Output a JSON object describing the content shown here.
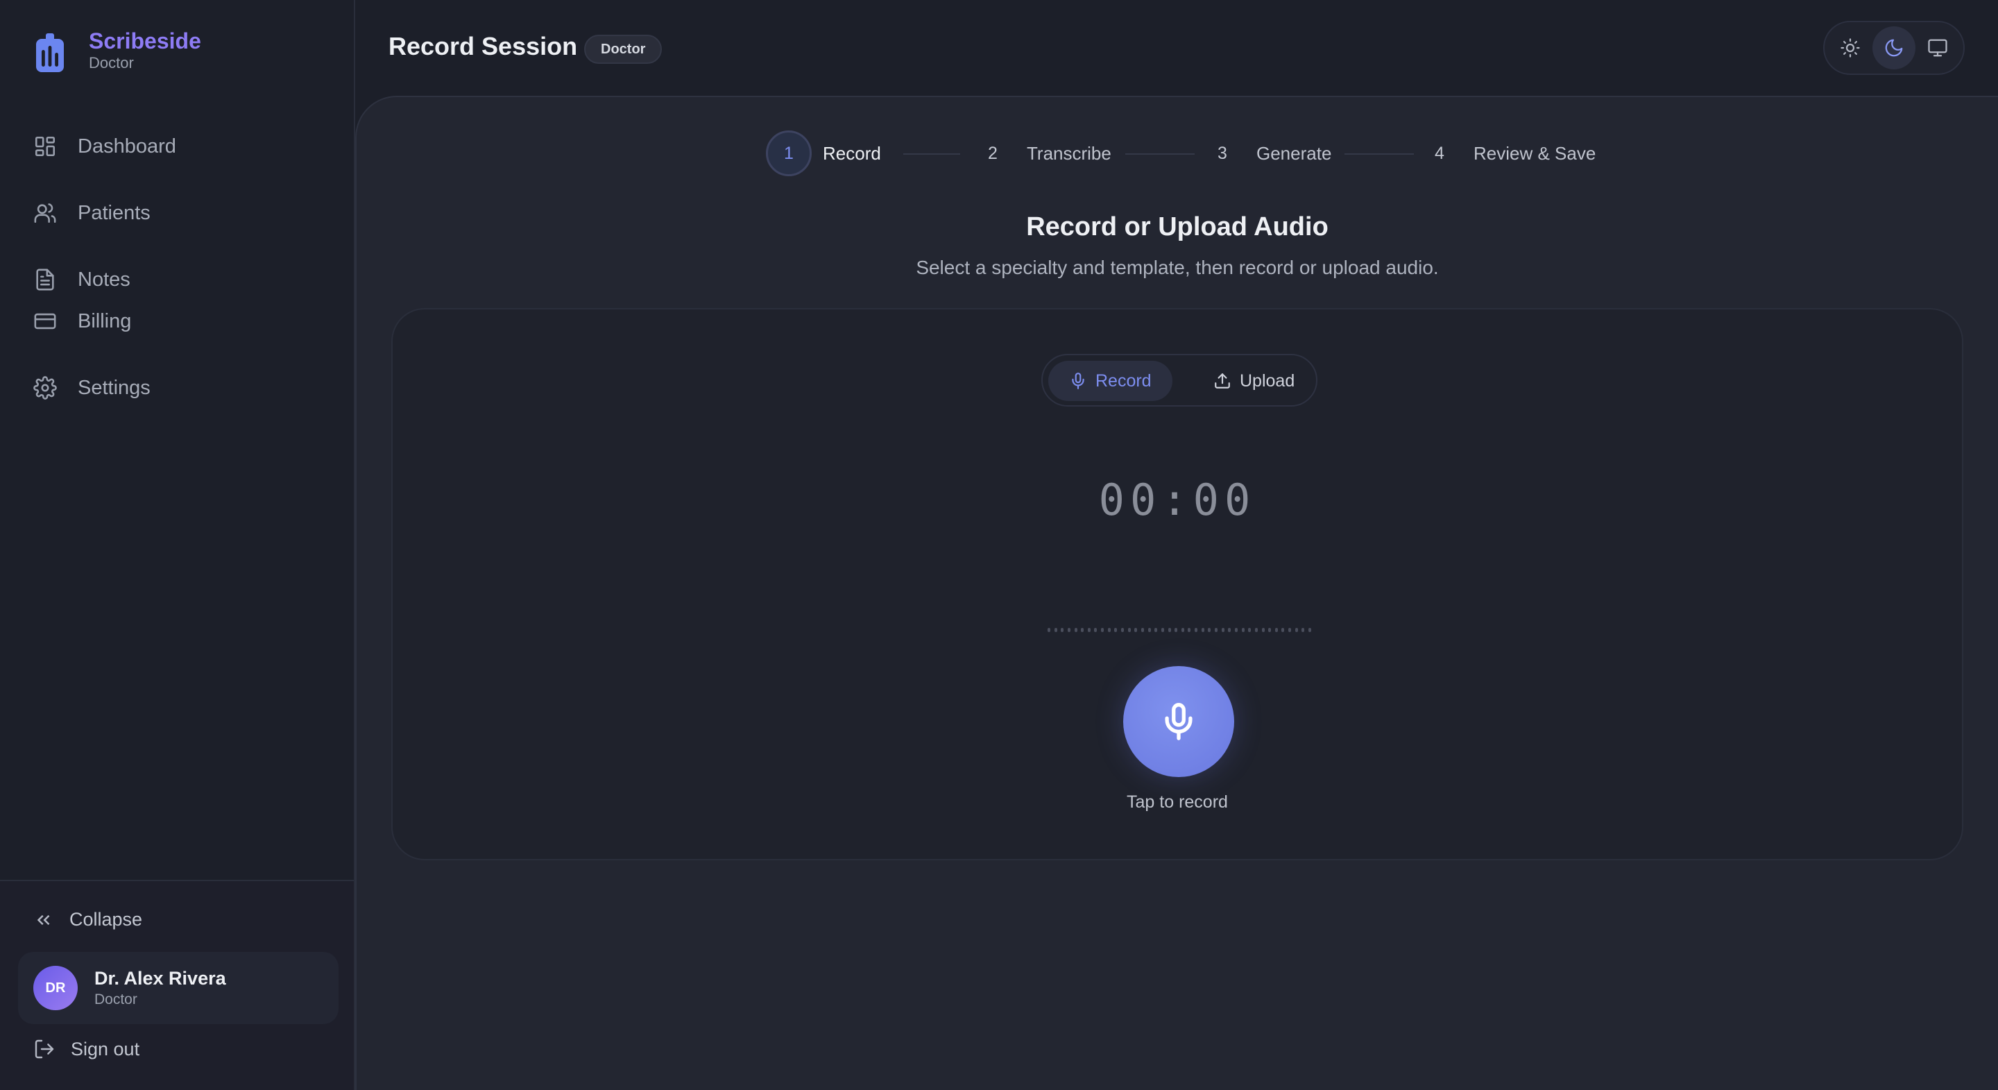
{
  "brand": {
    "name": "Scribeside",
    "role": "Doctor"
  },
  "sidebar": {
    "items": [
      {
        "label": "Dashboard",
        "icon": "dashboard-icon"
      },
      {
        "label": "Patients",
        "icon": "users-icon"
      },
      {
        "label": "Notes",
        "icon": "file-text-icon"
      },
      {
        "label": "Billing",
        "icon": "credit-card-icon"
      },
      {
        "label": "Settings",
        "icon": "gear-icon"
      }
    ],
    "collapse_label": "Collapse",
    "user": {
      "initials": "DR",
      "name": "Dr. Alex Rivera",
      "role": "Doctor"
    },
    "signout_label": "Sign out"
  },
  "header": {
    "title": "Record Session",
    "badge": "Doctor",
    "theme_options": [
      "light",
      "dark",
      "system"
    ],
    "active_theme": "dark"
  },
  "steps": [
    {
      "num": "1",
      "label": "Record",
      "active": true
    },
    {
      "num": "2",
      "label": "Transcribe",
      "active": false
    },
    {
      "num": "3",
      "label": "Generate",
      "active": false
    },
    {
      "num": "4",
      "label": "Review & Save",
      "active": false
    }
  ],
  "section": {
    "title": "Record or Upload Audio",
    "subtitle": "Select a specialty and template, then record or upload audio."
  },
  "recorder": {
    "mode_record_label": "Record",
    "mode_upload_label": "Upload",
    "active_mode": "Record",
    "timer": "00:00",
    "tap_label": "Tap to record"
  },
  "colors": {
    "background": "#1c1f29",
    "panel": "#232631",
    "accent": "#7d8ef0",
    "brand": "#8e7cf5"
  }
}
